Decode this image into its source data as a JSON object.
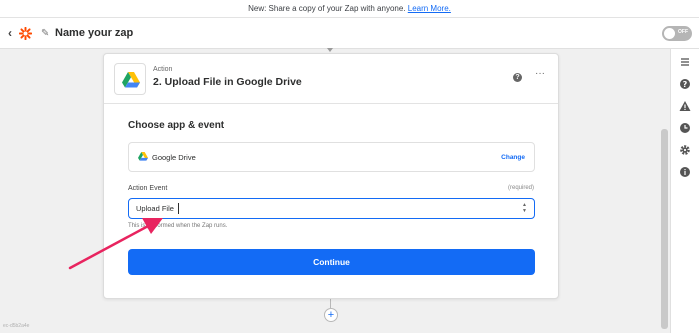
{
  "banner": {
    "text": "New: Share a copy of your Zap with anyone. ",
    "link": "Learn More."
  },
  "header": {
    "back": "‹",
    "zap_name": "Name your zap",
    "toggle_label": "OFF"
  },
  "step": {
    "type": "Action",
    "title": "2. Upload File in Google Drive"
  },
  "section": {
    "title": "Choose app & event",
    "app_name": "Google Drive",
    "change_label": "Change",
    "event_label": "Action Event",
    "required_label": "(required)",
    "event_value": "Upload File",
    "helper_text": "This is performed when the Zap runs.",
    "continue_label": "Continue"
  },
  "footer": {
    "plus": "+",
    "version": "ec-d5b2a4e"
  },
  "colors": {
    "accent": "#136bf5",
    "arrow": "#e8245f"
  },
  "icons": {
    "right_rail": [
      "outline-icon",
      "help-icon",
      "alert-icon",
      "history-icon",
      "settings-icon",
      "info-icon"
    ]
  }
}
